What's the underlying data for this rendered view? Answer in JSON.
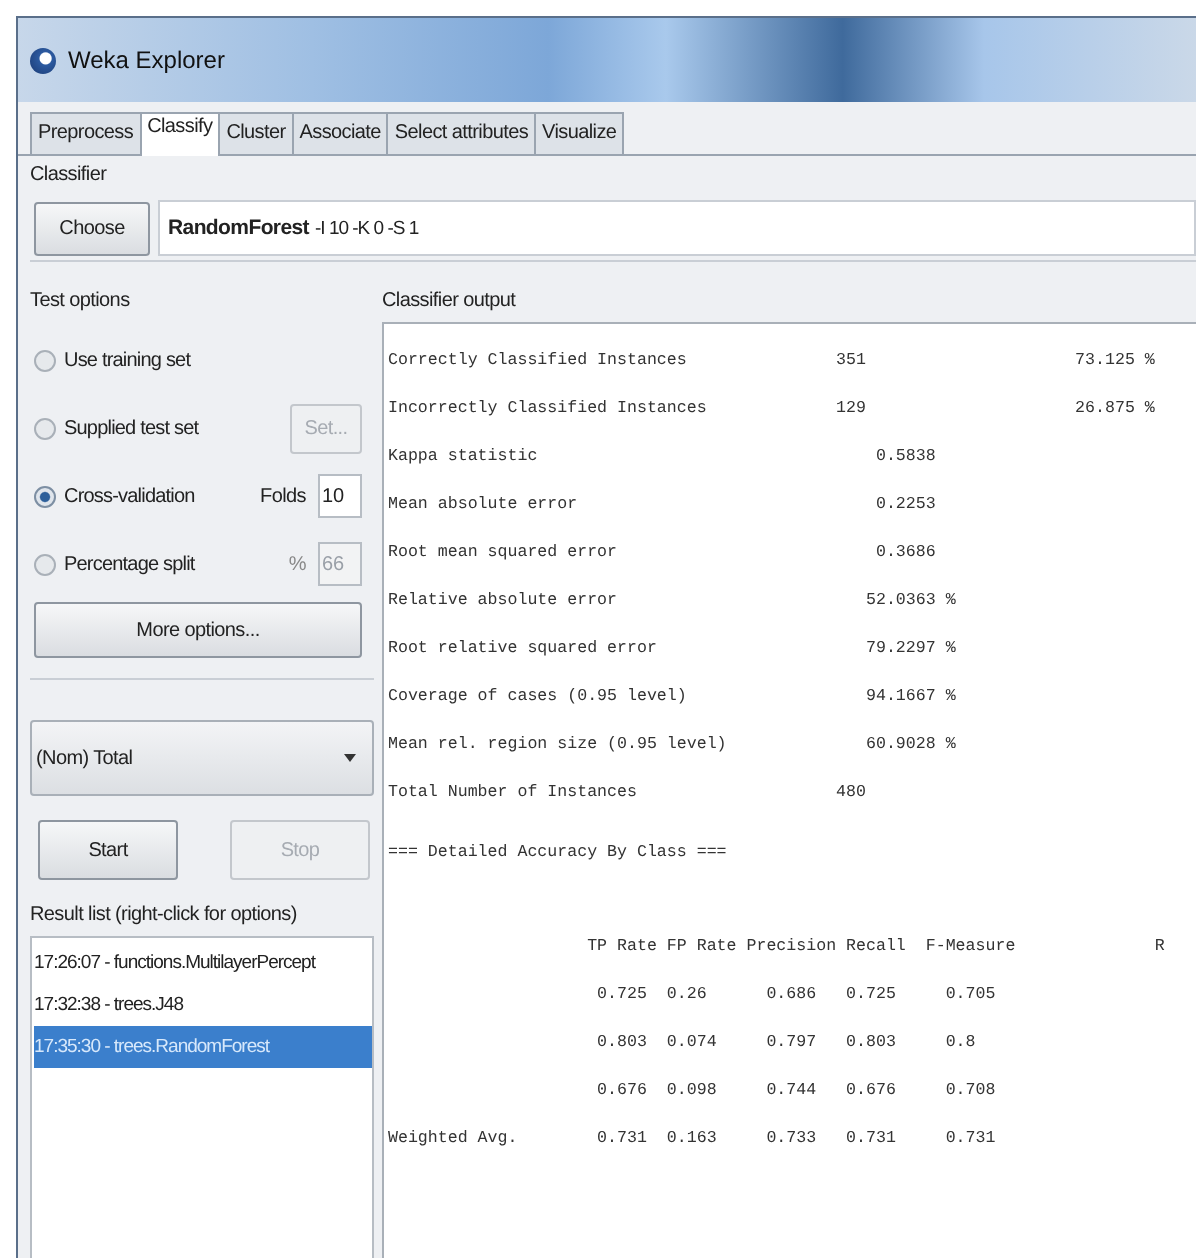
{
  "window": {
    "title": "Weka Explorer"
  },
  "tabs": [
    {
      "label": "Preprocess",
      "selected": false
    },
    {
      "label": "Classify",
      "selected": true
    },
    {
      "label": "Cluster",
      "selected": false
    },
    {
      "label": "Associate",
      "selected": false
    },
    {
      "label": "Select attributes",
      "selected": false
    },
    {
      "label": "Visualize",
      "selected": false
    }
  ],
  "classifier": {
    "label": "Classifier",
    "button": "Choose",
    "name": "RandomForest",
    "options": "-I 10 -K 0 -S 1"
  },
  "test_options": {
    "label": "Test options",
    "options": [
      {
        "label": "Use training set",
        "selected": false
      },
      {
        "label": "Supplied test set",
        "selected": false,
        "button": {
          "label": "Set...",
          "disabled": true
        }
      },
      {
        "label": "Cross-validation",
        "selected": true,
        "field": {
          "label": "Folds",
          "value": "10",
          "disabled": false
        }
      },
      {
        "label": "Percentage split",
        "selected": false,
        "field": {
          "label": "%",
          "value": "66",
          "disabled": true
        }
      }
    ],
    "more_button": "More options..."
  },
  "class_attribute": "(Nom) Total",
  "buttons": [
    {
      "label": "Start",
      "disabled": false
    },
    {
      "label": "Stop",
      "disabled": true
    }
  ],
  "result_list": {
    "label": "Result list (right-click for options)",
    "items": [
      {
        "label": "17:26:07 - functions.MultilayerPercept",
        "selected": false
      },
      {
        "label": "17:32:38 - trees.J48",
        "selected": false
      },
      {
        "label": "17:35:30 - trees.RandomForest",
        "selected": true
      }
    ]
  },
  "output": {
    "label": "Classifier output",
    "sections": [
      [
        "Correctly Classified Instances               351                     73.125 %",
        "Incorrectly Classified Instances             129                     26.875 %",
        "Kappa statistic                                  0.5838",
        "Mean absolute error                              0.2253",
        "Root mean squared error                          0.3686",
        "Relative absolute error                         52.0363 %",
        "Root relative squared error                     79.2297 %",
        "Coverage of cases (0.95 level)                  94.1667 %",
        "Mean rel. region size (0.95 level)              60.9028 %",
        "Total Number of Instances                    480"
      ],
      [
        "=== Detailed Accuracy By Class ==="
      ],
      [
        "                    TP Rate FP Rate Precision Recall  F-Measure              R",
        "                     0.725  0.26      0.686   0.725     0.705",
        "                     0.803  0.074     0.797   0.803     0.8",
        "                     0.676  0.098     0.744   0.676     0.708",
        "Weighted Avg.        0.731  0.163     0.733   0.731     0.731"
      ]
    ]
  }
}
